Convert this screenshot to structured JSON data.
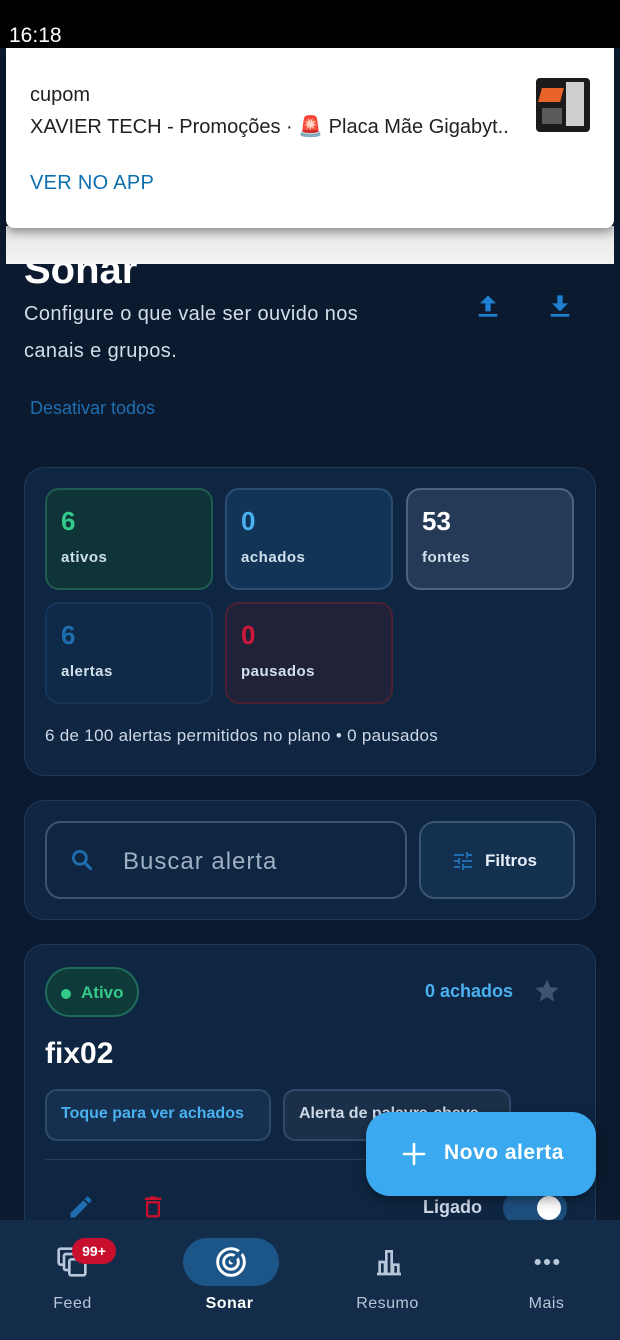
{
  "status_bar": {
    "time": "16:18"
  },
  "notification": {
    "title": "cupom",
    "body": "XAVIER TECH - Promoções · 🚨 Placa Mãe Gigabyt..",
    "action": "VER NO APP"
  },
  "header": {
    "title": "Sonar",
    "subtitle": "Configure o que vale ser ouvido nos canais e grupos.",
    "disable_all": "Desativar todos"
  },
  "stats": [
    {
      "value": "6",
      "label": "ativos",
      "color": "#34c98a"
    },
    {
      "value": "0",
      "label": "achados",
      "color": "#4ab1f0"
    },
    {
      "value": "53",
      "label": "fontes",
      "color": "#ffffff"
    },
    {
      "value": "6",
      "label": "alertas",
      "color": "#1f6fb0"
    },
    {
      "value": "0",
      "label": "pausados",
      "color": "#d2173a"
    }
  ],
  "plan_note": "6 de 100 alertas permitidos no plano • 0 pausados",
  "search": {
    "placeholder": "Buscar alerta",
    "filters_label": "Filtros"
  },
  "alert_card": {
    "status": "Ativo",
    "found": "0 achados",
    "name": "fix02",
    "chip_primary": "Toque para ver achados",
    "chip_secondary": "Alerta de palavra-chave",
    "switch_label": "Ligado",
    "switch_on": true
  },
  "fab": {
    "label": "Novo alerta"
  },
  "bottom_nav": {
    "items": [
      {
        "label": "Feed",
        "badge": "99+",
        "icon": "feed-icon"
      },
      {
        "label": "Sonar",
        "icon": "sonar-icon",
        "active": true
      },
      {
        "label": "Resumo",
        "icon": "bar-chart-icon"
      },
      {
        "label": "Mais",
        "icon": "more-icon"
      }
    ]
  }
}
